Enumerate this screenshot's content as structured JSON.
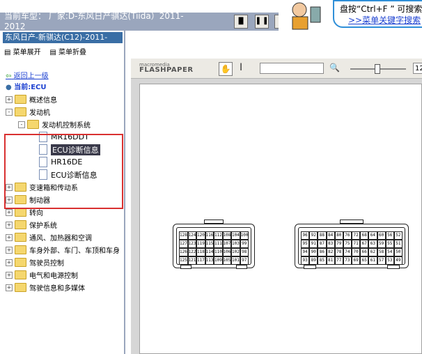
{
  "header": {
    "current_model": "当前车型： 厂家:D-东风日产骐达(Tiida）2011-2012",
    "buttons": [
      "single-page-icon",
      "two-page-icon"
    ]
  },
  "search_hint": {
    "line1": "盘按“Ctrl+F ” 可搜索文",
    "line2": ">>菜单关键字搜索"
  },
  "sidebar": {
    "model": "东风日产-新骐达(C12)-2011-",
    "expand_menu": "菜单展开",
    "collapse_menu": "菜单折叠",
    "back": "返回上一级",
    "current": "当前:ECU",
    "tree": [
      {
        "label": "概述信息",
        "type": "folder",
        "level": 0,
        "toggle": "+"
      },
      {
        "label": "发动机",
        "type": "folder",
        "level": 0,
        "toggle": "-"
      },
      {
        "label": "发动机控制系统",
        "type": "folder",
        "level": 1,
        "toggle": "-"
      },
      {
        "label": "MR16DDT",
        "type": "doc",
        "level": 2
      },
      {
        "label": "ECU诊断信息",
        "type": "doc",
        "level": 2,
        "selected": true
      },
      {
        "label": "HR16DE",
        "type": "doc",
        "level": 2
      },
      {
        "label": "ECU诊断信息",
        "type": "doc",
        "level": 2
      },
      {
        "label": "变速箱和传动系",
        "type": "folder",
        "level": 0,
        "toggle": "+"
      },
      {
        "label": "制动器",
        "type": "folder",
        "level": 0,
        "toggle": "+"
      },
      {
        "label": "转向",
        "type": "folder",
        "level": 0,
        "toggle": "+"
      },
      {
        "label": "保护系统",
        "type": "folder",
        "level": 0,
        "toggle": "+"
      },
      {
        "label": "通风、加热器和空调",
        "type": "folder",
        "level": 0,
        "toggle": "+"
      },
      {
        "label": "车身外部、车门、车顶和车身",
        "type": "folder",
        "level": 0,
        "toggle": "+"
      },
      {
        "label": "驾驶员控制",
        "type": "folder",
        "level": 0,
        "toggle": "+"
      },
      {
        "label": "电气和电源控制",
        "type": "folder",
        "level": 0,
        "toggle": "+"
      },
      {
        "label": "驾驶信息和多媒体",
        "type": "folder",
        "level": 0,
        "toggle": "+"
      }
    ]
  },
  "viewer": {
    "logo_small": "macromedia",
    "logo_big": "FLASHPAPER",
    "zoom": "12",
    "connector_left": [
      [
        "128",
        "124",
        "120",
        "116",
        "112",
        "108",
        "104",
        "100"
      ],
      [
        "127",
        "123",
        "119",
        "115",
        "111",
        "107",
        "103",
        "99"
      ],
      [
        "126",
        "122",
        "118",
        "114",
        "110",
        "106",
        "102",
        "98"
      ],
      [
        "125",
        "121",
        "117",
        "113",
        "109",
        "105",
        "101",
        "97"
      ]
    ],
    "connector_right": [
      [
        "96",
        "92",
        "88",
        "84",
        "80",
        "76",
        "72",
        "68",
        "64",
        "60",
        "56",
        "52"
      ],
      [
        "95",
        "91",
        "87",
        "83",
        "79",
        "75",
        "71",
        "67",
        "63",
        "59",
        "55",
        "51"
      ],
      [
        "94",
        "90",
        "86",
        "82",
        "78",
        "74",
        "70",
        "66",
        "62",
        "58",
        "54",
        "50"
      ],
      [
        "93",
        "89",
        "85",
        "81",
        "77",
        "73",
        "69",
        "65",
        "61",
        "57",
        "53",
        "49"
      ]
    ]
  }
}
